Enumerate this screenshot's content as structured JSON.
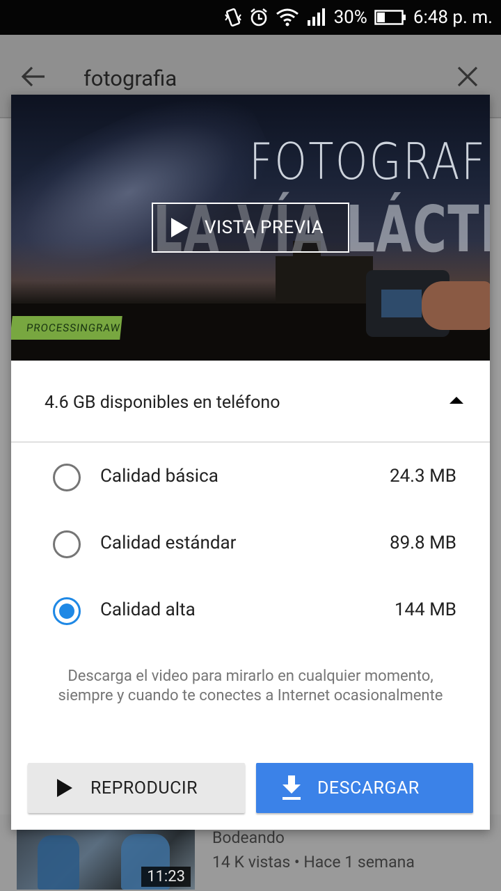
{
  "status_bar": {
    "battery_percent": "30%",
    "time": "6:48 p. m.",
    "icons": [
      "vibrate-icon",
      "alarm-icon",
      "wifi-icon",
      "signal-icon",
      "battery-icon"
    ]
  },
  "search": {
    "query": "fotografia"
  },
  "dialog": {
    "preview": {
      "title_line1": "FOTOGRAFÍA",
      "title_line2": "LA VÍA LÁCTEA",
      "tag": "PROCESSINGRAW",
      "button_label": "VISTA PREVIA"
    },
    "storage": {
      "text": "4.6 GB disponibles en teléfono"
    },
    "qualities": [
      {
        "label": "Calidad básica",
        "size": "24.3 MB",
        "selected": false
      },
      {
        "label": "Calidad estándar",
        "size": "89.8 MB",
        "selected": false
      },
      {
        "label": "Calidad alta",
        "size": "144 MB",
        "selected": true
      }
    ],
    "note": "Descarga el video para mirarlo en cualquier momento, siempre y cuando te conectes a Internet ocasionalmente",
    "buttons": {
      "play_label": "REPRODUCIR",
      "download_label": "DESCARGAR"
    },
    "colors": {
      "accent": "#1e88e5",
      "download_button": "#3b82e8"
    }
  },
  "background_item": {
    "duration": "11:23",
    "title": "Bodeando",
    "meta": "14 K vistas • Hace 1 semana"
  }
}
